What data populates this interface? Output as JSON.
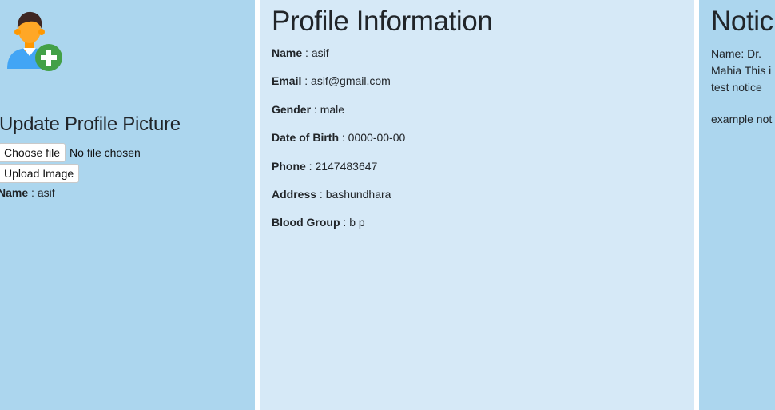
{
  "left_panel": {
    "avatar_icon": "user-add-icon",
    "heading": "Update Profile Picture",
    "choose_file_label": "Choose file",
    "no_file_text": "No file chosen",
    "upload_label": "Upload Image",
    "name_label": "Name",
    "name_value": "asif"
  },
  "profile": {
    "heading": "Profile Information",
    "fields": [
      {
        "label": "Name",
        "value": "asif"
      },
      {
        "label": "Email",
        "value": "asif@gmail.com"
      },
      {
        "label": "Gender",
        "value": "male"
      },
      {
        "label": "Date of Birth",
        "value": "0000-00-00"
      },
      {
        "label": "Phone",
        "value": "2147483647"
      },
      {
        "label": "Address",
        "value": "bashundhara"
      },
      {
        "label": "Blood Group",
        "value": "b p"
      }
    ]
  },
  "notice_panel": {
    "heading": "Notic",
    "line1": "Name: Dr.",
    "line2": "Mahia This i",
    "line3": "test notice",
    "line4": "example not"
  },
  "colors": {
    "side_panel_bg": "#acd6ee",
    "main_panel_bg": "#d6e9f7",
    "avatar_skin": "#ffa726",
    "avatar_hair": "#3e2723",
    "avatar_shirt": "#42a5f5",
    "add_badge": "#43a047"
  }
}
